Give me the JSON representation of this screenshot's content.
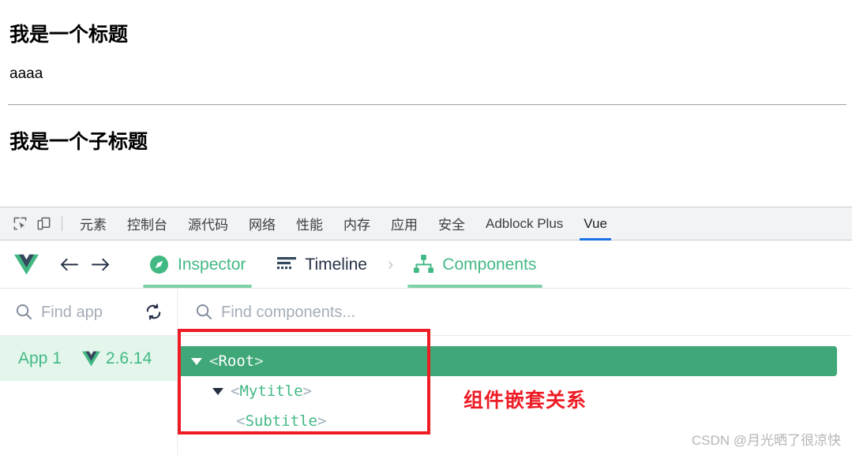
{
  "page": {
    "heading_main": "我是一个标题",
    "body_text": "aaaa",
    "heading_sub": "我是一个子标题"
  },
  "devtools": {
    "icons": {
      "inspect": "inspect-element-icon",
      "device": "device-toolbar-icon"
    },
    "tabs": [
      {
        "label": "元素",
        "active": false
      },
      {
        "label": "控制台",
        "active": false
      },
      {
        "label": "源代码",
        "active": false
      },
      {
        "label": "网络",
        "active": false
      },
      {
        "label": "性能",
        "active": false
      },
      {
        "label": "内存",
        "active": false
      },
      {
        "label": "应用",
        "active": false
      },
      {
        "label": "安全",
        "active": false
      },
      {
        "label": "Adblock Plus",
        "active": false
      },
      {
        "label": "Vue",
        "active": true
      }
    ],
    "active_tab_accent": "#1a73e8"
  },
  "vue_header": {
    "logo": "vue-logo-icon",
    "back": "back-arrow-icon",
    "forward": "forward-arrow-icon",
    "tabs": [
      {
        "label": "Inspector",
        "icon": "compass-icon",
        "active": true
      },
      {
        "label": "Timeline",
        "icon": "timeline-icon",
        "active": false
      }
    ],
    "chevron": "›",
    "sub_tabs": [
      {
        "label": "Components",
        "icon": "components-tree-icon",
        "active": true
      }
    ],
    "accent": "#42b983"
  },
  "search": {
    "app_placeholder": "Find app",
    "components_placeholder": "Find components...",
    "search_icon": "search-icon",
    "refresh_icon": "refresh-icon"
  },
  "apps": [
    {
      "name": "App 1",
      "version": "2.6.14",
      "selected": true
    }
  ],
  "tree": {
    "nodes": [
      {
        "label": "<Root>",
        "open": "<",
        "name": "Root",
        "close": ">",
        "depth": 0,
        "expanded": true,
        "selected": true
      },
      {
        "label": "<Mytitle>",
        "open": "<",
        "name": "Mytitle",
        "close": ">",
        "depth": 1,
        "expanded": true,
        "selected": false
      },
      {
        "label": "<Subtitle>",
        "open": "<",
        "name": "Subtitle",
        "close": ">",
        "depth": 2,
        "expanded": false,
        "selected": false
      }
    ],
    "selected_bg": "#3fa778"
  },
  "annotations": {
    "box_color": "#ee1c25",
    "note": "组件嵌套关系",
    "watermark": "CSDN @月光晒了很凉快"
  }
}
